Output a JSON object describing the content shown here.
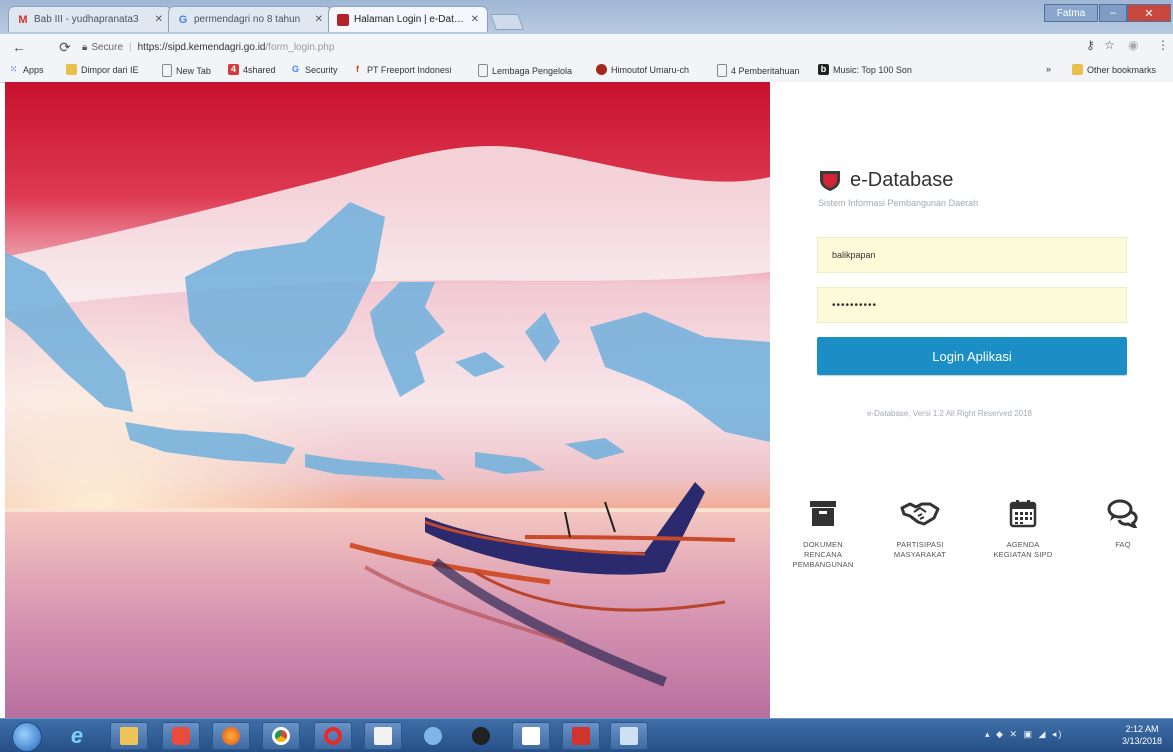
{
  "browser": {
    "tabs": [
      {
        "icon": "gmail-icon",
        "title": "Bab III - yudhapranata3",
        "active": false
      },
      {
        "icon": "google-icon",
        "title": "permendagri no 8 tahun",
        "active": false
      },
      {
        "icon": "sipd-favicon-icon",
        "title": "Halaman Login | e-Datab",
        "active": true
      }
    ],
    "user_label": "Fatma",
    "address": {
      "secure_label": "Secure",
      "host": "https://sipd.kemendagri.go.id",
      "path": "/form_login.php"
    },
    "bookmarks": [
      {
        "icon": "apps-icon",
        "label": "Apps"
      },
      {
        "icon": "folder-icon",
        "label": "Dimpor dari IE"
      },
      {
        "icon": "page-icon",
        "label": "New Tab"
      },
      {
        "icon": "4shared-icon",
        "label": "4shared"
      },
      {
        "icon": "google-icon",
        "label": "Security"
      },
      {
        "icon": "freeport-icon",
        "label": "PT Freeport Indonesi"
      },
      {
        "icon": "page-icon",
        "label": "Lembaga Pengelola"
      },
      {
        "icon": "himoutof-icon",
        "label": "Himoutof Umaru-ch"
      },
      {
        "icon": "page-icon",
        "label": "4 Pemberitahuan"
      },
      {
        "icon": "music-icon",
        "label": "Music: Top 100 Son"
      }
    ],
    "other_bookmarks": "Other bookmarks",
    "overflow": "»"
  },
  "login": {
    "app_title": "e-Database",
    "subtitle": "Sistem Informasi Pembangunan Daerah",
    "username_value": "balikpapan",
    "password_value": "••••••••••",
    "submit_label": "Login Aplikasi",
    "copyright": "e-Database, Versi 1.2 All Right Reserved 2018"
  },
  "menu": [
    {
      "icon": "archive-box-icon",
      "line1": "DOKUMEN",
      "line2": "RENCANA",
      "line3": "PEMBANGUNAN"
    },
    {
      "icon": "handshake-icon",
      "line1": "PARTISIPASI",
      "line2": "MASYARAKAT",
      "line3": ""
    },
    {
      "icon": "calendar-icon",
      "line1": "AGENDA",
      "line2": "KEGIATAN SIPD",
      "line3": ""
    },
    {
      "icon": "chat-bubbles-icon",
      "line1": "FAQ",
      "line2": "",
      "line3": ""
    }
  ],
  "taskbar": {
    "time": "2:12 AM",
    "date": "3/13/2018"
  },
  "colors": {
    "accent": "#1a8ec5",
    "field_bg": "#fbfbd9",
    "sky_red": "#c9162e"
  }
}
